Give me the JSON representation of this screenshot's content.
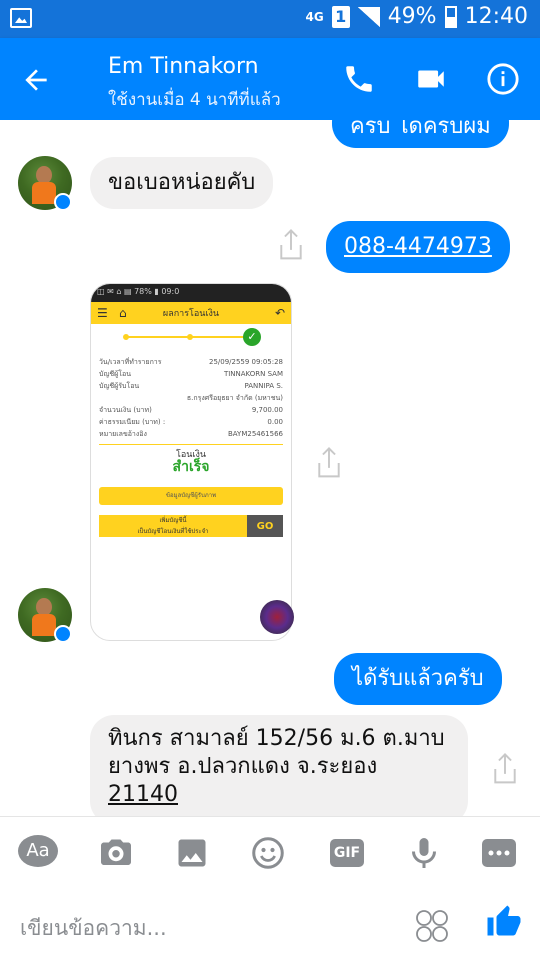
{
  "status": {
    "network": "4G",
    "sim": "1",
    "battery": "49%",
    "time": "12:40"
  },
  "header": {
    "title": "Em Tinnakorn",
    "subtitle": "ใช้งานเมื่อ 4 นาทีที่แล้ว"
  },
  "messages": {
    "top_partial": "ครับ ได้ครับผม",
    "incoming_1": "ขอเบอหน่อยคับ",
    "outgoing_phone": "088-4474973",
    "outgoing_2": "ได้รับแล้วครับ",
    "incoming_2_line1": "ทินกร สามาลย์ 152/56 ม.6 ต.มาบ",
    "incoming_2_line2": "ยางพร อ.ปลวกแดง จ.ระยอง",
    "incoming_2_line3": "21140"
  },
  "receipt": {
    "status_bar": "◫ ✉ ⌂ ▤ 78% ▮ 09:0",
    "header": "ผลการโอนเงิน",
    "rows": [
      {
        "label": "วัน/เวลาที่ทำรายการ",
        "value": "25/09/2559 09:05:28"
      },
      {
        "label": "บัญชีผู้โอน",
        "value": "TINNAKORN SAM"
      },
      {
        "label": "บัญชีผู้รับโอน",
        "value": "PANNIPA S."
      },
      {
        "label": "",
        "value": "ธ.กรุงศรีอยุธยา จำกัด (มหาชน)"
      },
      {
        "label": "จำนวนเงิน (บาท)",
        "value": "9,700.00"
      },
      {
        "label": "ค่าธรรมเนียม (บาท) :",
        "value": "0.00"
      },
      {
        "label": "หมายเลขอ้างอิง",
        "value": "BAYM25461566"
      }
    ],
    "transfer_label": "โอนเงิน",
    "success_label": "สำเร็จ",
    "save_button": "ข้อมูลบัญชีผู้รับภาพ",
    "add_line1": "เพิ่มบัญชีนี้",
    "add_line2": "เป็นบัญชีโอนเงินที่ใช้ประจำ",
    "go": "GO"
  },
  "toolbar": {
    "aa": "Aa",
    "gif": "GIF"
  },
  "composer": {
    "placeholder": "เขียนข้อความ..."
  },
  "colors": {
    "accent": "#0084ff",
    "status": "#1473d9"
  }
}
